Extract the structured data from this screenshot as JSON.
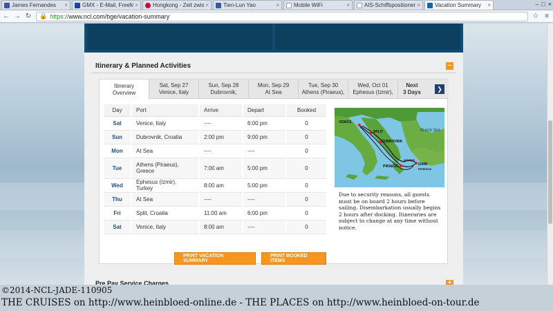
{
  "browser": {
    "tabs": [
      {
        "label": "James Fernandes",
        "favicon_color": "#3b5998",
        "active": false
      },
      {
        "label": "GMX - E-Mail, FreeMa",
        "favicon_color": "#1c449b",
        "active": false
      },
      {
        "label": "Hongkong - Zeit zwis",
        "favicon_color": "#c8102e",
        "active": false
      },
      {
        "label": "Tien-Lun Yao",
        "favicon_color": "#3b5998",
        "active": false
      },
      {
        "label": "Mobile WiFi",
        "favicon_color": "#9aa4ad",
        "active": false
      },
      {
        "label": "AIS-Schiffspositionen",
        "favicon_color": "#9aa4ad",
        "active": false
      },
      {
        "label": "Vacation Summary",
        "favicon_color": "#1565a8",
        "active": true
      }
    ],
    "url_secure": "https://",
    "url_rest": "www.ncl.com/bge/vacation-summary"
  },
  "section": {
    "title": "Itinerary & Planned Activities",
    "collapse_symbol": "–"
  },
  "day_tabs": [
    {
      "date": "Itinerary",
      "place": "Overview",
      "active": true
    },
    {
      "date": "Sat, Sep 27",
      "place": "Venice, Italy",
      "active": false
    },
    {
      "date": "Sun, Sep 28",
      "place": "Dubrovnik,",
      "active": false
    },
    {
      "date": "Mon, Sep 29",
      "place": "At Sea",
      "active": false
    },
    {
      "date": "Tue, Sep 30",
      "place": "Athens (Piraeus),",
      "active": false
    },
    {
      "date": "Wed, Oct 01",
      "place": "Ephesus (Izmir),",
      "active": false
    }
  ],
  "next_tab": {
    "line1": "Next",
    "line2": "3 Days"
  },
  "table": {
    "headers": {
      "day": "Day",
      "port": "Port",
      "arrive": "Arrive",
      "depart": "Depart",
      "booked": "Booked"
    },
    "rows": [
      {
        "day": "Sat",
        "port": "Venice, Italy",
        "arrive": "----",
        "depart": "6:00 pm",
        "booked": "0"
      },
      {
        "day": "Sun",
        "port": "Dubrovnik, Croatia",
        "arrive": "2:00 pm",
        "depart": "9:00 pm",
        "booked": "0"
      },
      {
        "day": "Mon",
        "port": "At Sea",
        "arrive": "----",
        "depart": "----",
        "booked": "0"
      },
      {
        "day": "Tue",
        "port": "Athens (Piraeus), Greece",
        "arrive": "7:00 am",
        "depart": "5:00 pm",
        "booked": "0"
      },
      {
        "day": "Wed",
        "port": "Ephesus (Izmir), Turkey",
        "arrive": "8:00 am",
        "depart": "5:00 pm",
        "booked": "0"
      },
      {
        "day": "Thu",
        "port": "At Sea",
        "arrive": "----",
        "depart": "----",
        "booked": "0"
      },
      {
        "day": "Fri",
        "port": "Split, Croatia",
        "arrive": "11:00 am",
        "depart": "6:00 pm",
        "booked": "0"
      },
      {
        "day": "Sat",
        "port": "Venice, Italy",
        "arrive": "8:00 am",
        "depart": "----",
        "booked": "0"
      }
    ]
  },
  "map": {
    "labels": {
      "venice": "VENICE",
      "split": "SPLIT",
      "dubrovnik": "DUBROVNIK",
      "piraeus": "PIRAEUS",
      "izmir": "IZMIR",
      "athens": "ATHENS",
      "ephesus": "EPHESUS",
      "black_sea": "BLACK SEA"
    }
  },
  "notice": "Due to security reasons, all guests must be on board 2 hours before sailing. Disembarkation usually begins 2 hours after docking. Itineraries are subject to change at any time without notice.",
  "buttons": {
    "print_summary": "PRINT VACATION SUMMARY",
    "print_booked": "PRINT BOOKED ITEMS"
  },
  "prepay": {
    "title": "Pre Pay Service Charges",
    "expand_symbol": "+"
  },
  "watermark": {
    "line1": "©2014-NCL-JADE-110905",
    "line2": "THE CRUISES on http://www.heinbloed-online.de - THE PLACES on http://www.heinbloed-on-tour.de"
  },
  "colors": {
    "accent": "#f5961e",
    "header_blue": "#0f4d72",
    "day_blue": "#1e4f86"
  }
}
